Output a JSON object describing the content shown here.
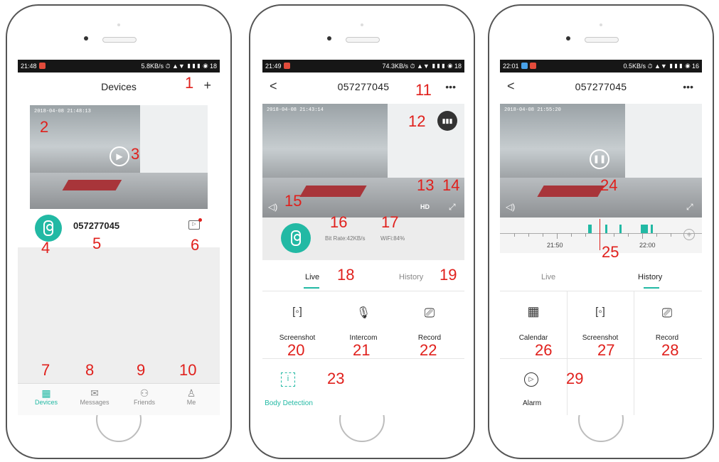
{
  "colors": {
    "accent": "#22b9a4",
    "marker": "#e0201c",
    "statusbar": "#161616"
  },
  "phone1": {
    "status": {
      "time": "21:48",
      "right": "5.8KB/s ⏱ ▲▼ ▮▮▮ ◉ 18"
    },
    "title": "Devices",
    "add_icon": "plus-icon",
    "add_label": "+",
    "video_timestamp": "2018-04-08 21:48:13",
    "device_name": "057277045",
    "markers": [
      "1",
      "2",
      "3",
      "4",
      "5",
      "6",
      "7",
      "8",
      "9",
      "10"
    ],
    "tabs": [
      {
        "label": "Devices",
        "icon": "grid-icon",
        "glyph": "▦"
      },
      {
        "label": "Messages",
        "icon": "message-icon",
        "glyph": "✉"
      },
      {
        "label": "Friends",
        "icon": "friends-icon",
        "glyph": "⚇"
      },
      {
        "label": "Me",
        "icon": "user-icon",
        "glyph": "♙"
      }
    ]
  },
  "phone2": {
    "status": {
      "time": "21:49",
      "right": "74.3KB/s ⏱ ▲▼ ▮▮▮ ◉ 18"
    },
    "title": "057277045",
    "back": "<",
    "more": "•••",
    "video_timestamp": "2018-04-08 21:43:14",
    "hd": "HD",
    "bit_rate": "Bit Rate:42KB/s",
    "wifi": "WiFi:84%",
    "tab_live": "Live",
    "tab_history": "History",
    "actions": [
      {
        "label": "Screenshot",
        "icon": "screenshot-icon",
        "glyph": "[◦]"
      },
      {
        "label": "Intercom",
        "icon": "microphone-icon",
        "glyph": "🎙"
      },
      {
        "label": "Record",
        "icon": "record-icon",
        "glyph": "⎚"
      }
    ],
    "body_detection": "Body Detection",
    "markers": [
      "11",
      "12",
      "13",
      "14",
      "15",
      "16",
      "17",
      "18",
      "19",
      "20",
      "21",
      "22",
      "23"
    ]
  },
  "phone3": {
    "status": {
      "time": "22:01",
      "right": "0.5KB/s ⏱ ▲▼ ▮▮▮ ◉ 16"
    },
    "title": "057277045",
    "back": "<",
    "more": "•••",
    "video_timestamp": "2018-04-08 21:55:20",
    "timeline_labels": [
      "21:50",
      "22:00"
    ],
    "tab_live": "Live",
    "tab_history": "History",
    "actions": [
      {
        "label": "Calendar",
        "icon": "calendar-icon",
        "glyph": "▦"
      },
      {
        "label": "Screenshot",
        "icon": "screenshot-icon",
        "glyph": "[◦]"
      },
      {
        "label": "Record",
        "icon": "record-icon",
        "glyph": "⎚"
      }
    ],
    "alarm": "Alarm",
    "markers": [
      "24",
      "25",
      "26",
      "27",
      "28",
      "29"
    ]
  }
}
